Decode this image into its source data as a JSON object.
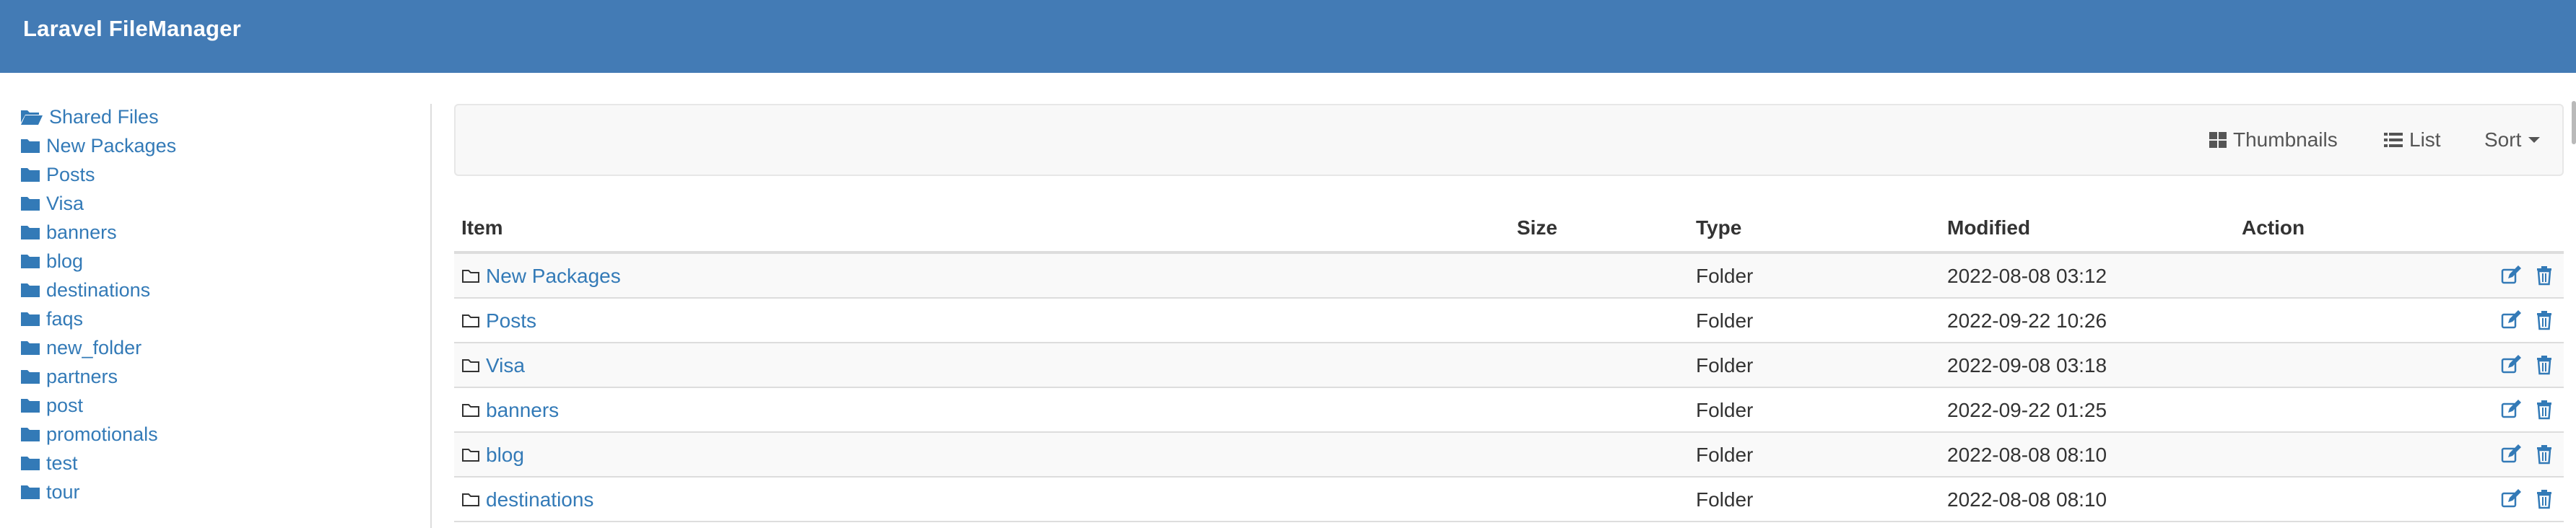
{
  "app": {
    "title": "Laravel FileManager"
  },
  "sidebar": {
    "items": [
      {
        "label": "Shared Files",
        "icon": "folder-open-icon"
      },
      {
        "label": "New Packages",
        "icon": "folder-icon"
      },
      {
        "label": "Posts",
        "icon": "folder-icon"
      },
      {
        "label": "Visa",
        "icon": "folder-icon"
      },
      {
        "label": "banners",
        "icon": "folder-icon"
      },
      {
        "label": "blog",
        "icon": "folder-icon"
      },
      {
        "label": "destinations",
        "icon": "folder-icon"
      },
      {
        "label": "faqs",
        "icon": "folder-icon"
      },
      {
        "label": "new_folder",
        "icon": "folder-icon"
      },
      {
        "label": "partners",
        "icon": "folder-icon"
      },
      {
        "label": "post",
        "icon": "folder-icon"
      },
      {
        "label": "promotionals",
        "icon": "folder-icon"
      },
      {
        "label": "test",
        "icon": "folder-icon"
      },
      {
        "label": "tour",
        "icon": "folder-icon"
      }
    ]
  },
  "toolbar": {
    "thumbnails_label": "Thumbnails",
    "list_label": "List",
    "sort_label": "Sort"
  },
  "table": {
    "headers": {
      "item": "Item",
      "size": "Size",
      "type": "Type",
      "modified": "Modified",
      "action": "Action"
    },
    "rows": [
      {
        "name": "New Packages",
        "size": "",
        "type": "Folder",
        "modified": "2022-08-08 03:12"
      },
      {
        "name": "Posts",
        "size": "",
        "type": "Folder",
        "modified": "2022-09-22 10:26"
      },
      {
        "name": "Visa",
        "size": "",
        "type": "Folder",
        "modified": "2022-09-08 03:18"
      },
      {
        "name": "banners",
        "size": "",
        "type": "Folder",
        "modified": "2022-09-22 01:25"
      },
      {
        "name": "blog",
        "size": "",
        "type": "Folder",
        "modified": "2022-08-08 08:10"
      },
      {
        "name": "destinations",
        "size": "",
        "type": "Folder",
        "modified": "2022-08-08 08:10"
      }
    ]
  },
  "colors": {
    "navbar": "#437bb5",
    "link": "#337ab7",
    "text": "#333333"
  }
}
